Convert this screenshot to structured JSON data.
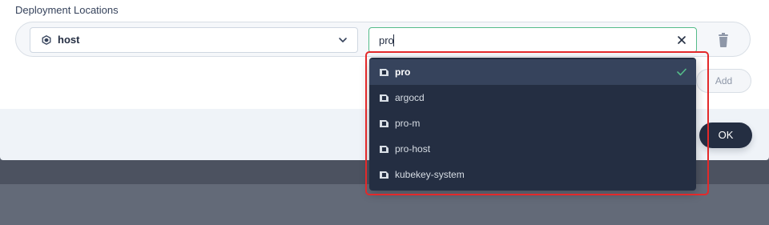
{
  "section": {
    "label": "Deployment Locations"
  },
  "cluster_select": {
    "value": "host",
    "icon": "cluster-icon"
  },
  "namespace_input": {
    "value": "pro"
  },
  "add_label": "Add",
  "ok_label": "OK",
  "dropdown": {
    "items": [
      {
        "label": "pro",
        "selected": true
      },
      {
        "label": "argocd",
        "selected": false
      },
      {
        "label": "pro-m",
        "selected": false
      },
      {
        "label": "pro-host",
        "selected": false
      },
      {
        "label": "kubekey-system",
        "selected": false
      }
    ]
  },
  "colors": {
    "accent_green": "#55bc8a",
    "dark": "#242e42",
    "dropdown_selected": "#36435c",
    "highlight_red": "#e3292a"
  }
}
